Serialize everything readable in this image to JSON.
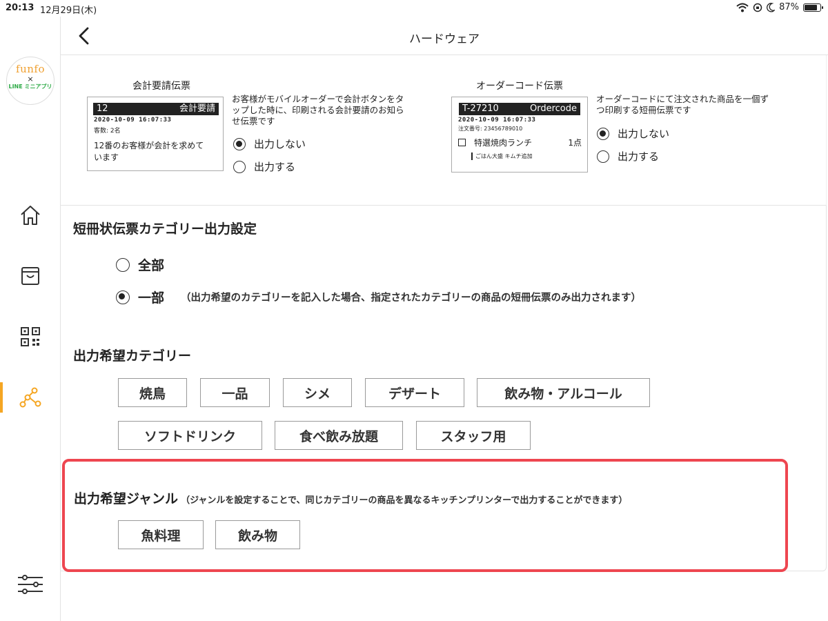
{
  "status": {
    "time": "20:13",
    "date": "12月29日(木)",
    "battery": "87%",
    "battery_level": 0.87
  },
  "sidebar": {
    "logo": {
      "line1": "funfo",
      "line2": "×",
      "line3": "LINE ミニアプリ"
    },
    "items": [
      {
        "icon": "home-icon"
      },
      {
        "icon": "bag-icon"
      },
      {
        "icon": "qr-code-icon"
      },
      {
        "icon": "network-icon",
        "active": true
      },
      {
        "icon": "settings-sliders-icon"
      }
    ],
    "accent": "#f5a623"
  },
  "header": {
    "title": "ハードウェア"
  },
  "checkout_slip": {
    "title": "会計要請伝票",
    "table": "12",
    "label": "会計要請",
    "datetime": "2020-10-09 16:07:33",
    "guests": "客数: 2名",
    "message_line1": "12番のお客様が会計を求めて",
    "message_line2": "います",
    "description_line1": "お客様がモバイルオーダーで会計ボタンをタ",
    "description_line2": "ップした時に、印刷される会計要請のお知ら",
    "description_line3": "せ伝票です",
    "options": [
      "出力しない",
      "出力する"
    ],
    "selected": 0
  },
  "ordercode_slip": {
    "title": "オーダーコード伝票",
    "code": "T-27210",
    "label": "Ordercode",
    "datetime": "2020-10-09 16:07:33",
    "order_no": "注文番号: 23456789010",
    "item": "特選焼肉ランチ",
    "qty": "1点",
    "options_note": "ごはん大盛  キムチ追加",
    "description_line1": "オーダーコードにて注文された商品を一個ず",
    "description_line2": "つ印刷する短冊伝票です",
    "options": [
      "出力しない",
      "出力する"
    ],
    "selected": 0
  },
  "category_output": {
    "title": "短冊状伝票カテゴリー出力設定",
    "options": [
      "全部",
      "一部"
    ],
    "selected": 1,
    "note": "（出力希望のカテゴリーを記入した場合、指定されたカテゴリーの商品の短冊伝票のみ出力されます）"
  },
  "desired_categories": {
    "title": "出力希望カテゴリー",
    "tags": [
      "焼鳥",
      "一品",
      "シメ",
      "デザート",
      "飲み物・アルコール",
      "ソフトドリンク",
      "食べ飲み放題",
      "スタッフ用"
    ]
  },
  "desired_genres": {
    "title": "出力希望ジャンル",
    "note": "（ジャンルを設定することで、同じカテゴリーの商品を異なるキッチンプリンターで出力することができます）",
    "tags": [
      "魚料理",
      "飲み物"
    ],
    "highlight_color": "#ee4650"
  }
}
